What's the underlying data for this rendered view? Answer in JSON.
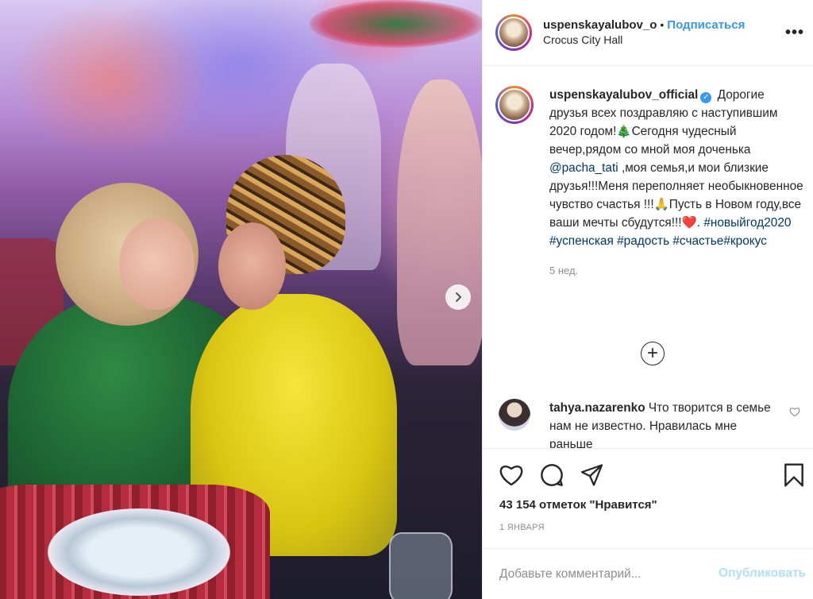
{
  "colors": {
    "accent": "#3897f0",
    "publish_disabled": "#b2dffc",
    "muted": "#8e8e8e"
  },
  "header": {
    "username": "uspenskayalubov_o",
    "dot": "•",
    "follow_label": "Подписаться",
    "location": "Crocus City Hall",
    "more_icon": "more-horizontal-icon"
  },
  "caption": {
    "username": "uspenskayalubov_official",
    "text_1": "Дорогие друзья всех поздравляю с наступившим 2020 годом!🎄Сегодня чудесный вечер,рядом со мной моя доченька",
    "mention": "@pacha_tati",
    "text_2": ",моя семья,и мои близкие друзья!!!Меня переполняет необыкновенное чувство счастья !!!🙏Пусть в Новом году,все ваши мечты сбудутся!!!❤️.",
    "hashtags": "#новыйгод2020 #успенская #радость #счастье#крокус",
    "time": "5 нед."
  },
  "load_more_label": "+",
  "comment": {
    "username": "tahya.nazarenko",
    "text": "Что творится в семье нам не известно. Нравилась мне раньше"
  },
  "actions": {
    "like_icon": "heart-icon",
    "comment_icon": "comment-icon",
    "share_icon": "share-icon",
    "save_icon": "bookmark-icon"
  },
  "likes_text": "43 154 отметок \"Нравится\"",
  "date_text": "1 ЯНВАРЯ",
  "comment_input": {
    "placeholder": "Добавьте комментарий...",
    "submit_label": "Опубликовать"
  },
  "photo": {
    "next_icon": "chevron-right-icon"
  }
}
